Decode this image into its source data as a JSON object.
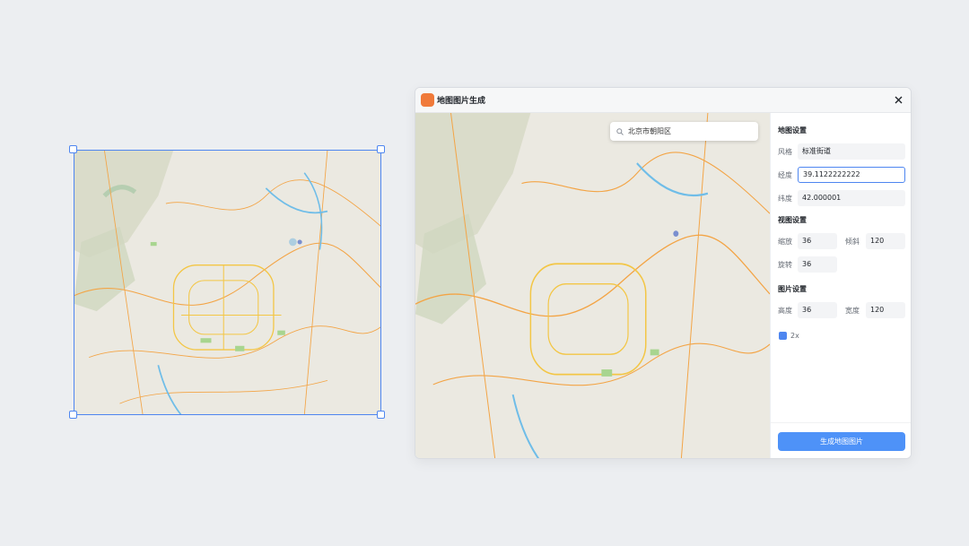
{
  "dialog": {
    "title": "地图图片生成",
    "search": {
      "value": "北京市朝阳区"
    },
    "map_settings": {
      "title": "地图设置",
      "style_label": "风格",
      "style_value": "标准街道",
      "lng_label": "经度",
      "lng_value": "39.1122222222",
      "lat_label": "纬度",
      "lat_value": "42.000001"
    },
    "view_settings": {
      "title": "视图设置",
      "zoom_label": "缩放",
      "zoom_value": "36",
      "tilt_label": "倾斜",
      "tilt_value": "120",
      "rotate_label": "旋转",
      "rotate_value": "36"
    },
    "image_settings": {
      "title": "图片设置",
      "height_label": "高度",
      "height_value": "36",
      "width_label": "宽度",
      "width_value": "120",
      "retina_label": "2x",
      "retina_checked": true
    },
    "generate_button": "生成地图图片"
  },
  "colors": {
    "accent": "#4e86f0",
    "button": "#4e92f8",
    "logo": "#f07a3a"
  }
}
